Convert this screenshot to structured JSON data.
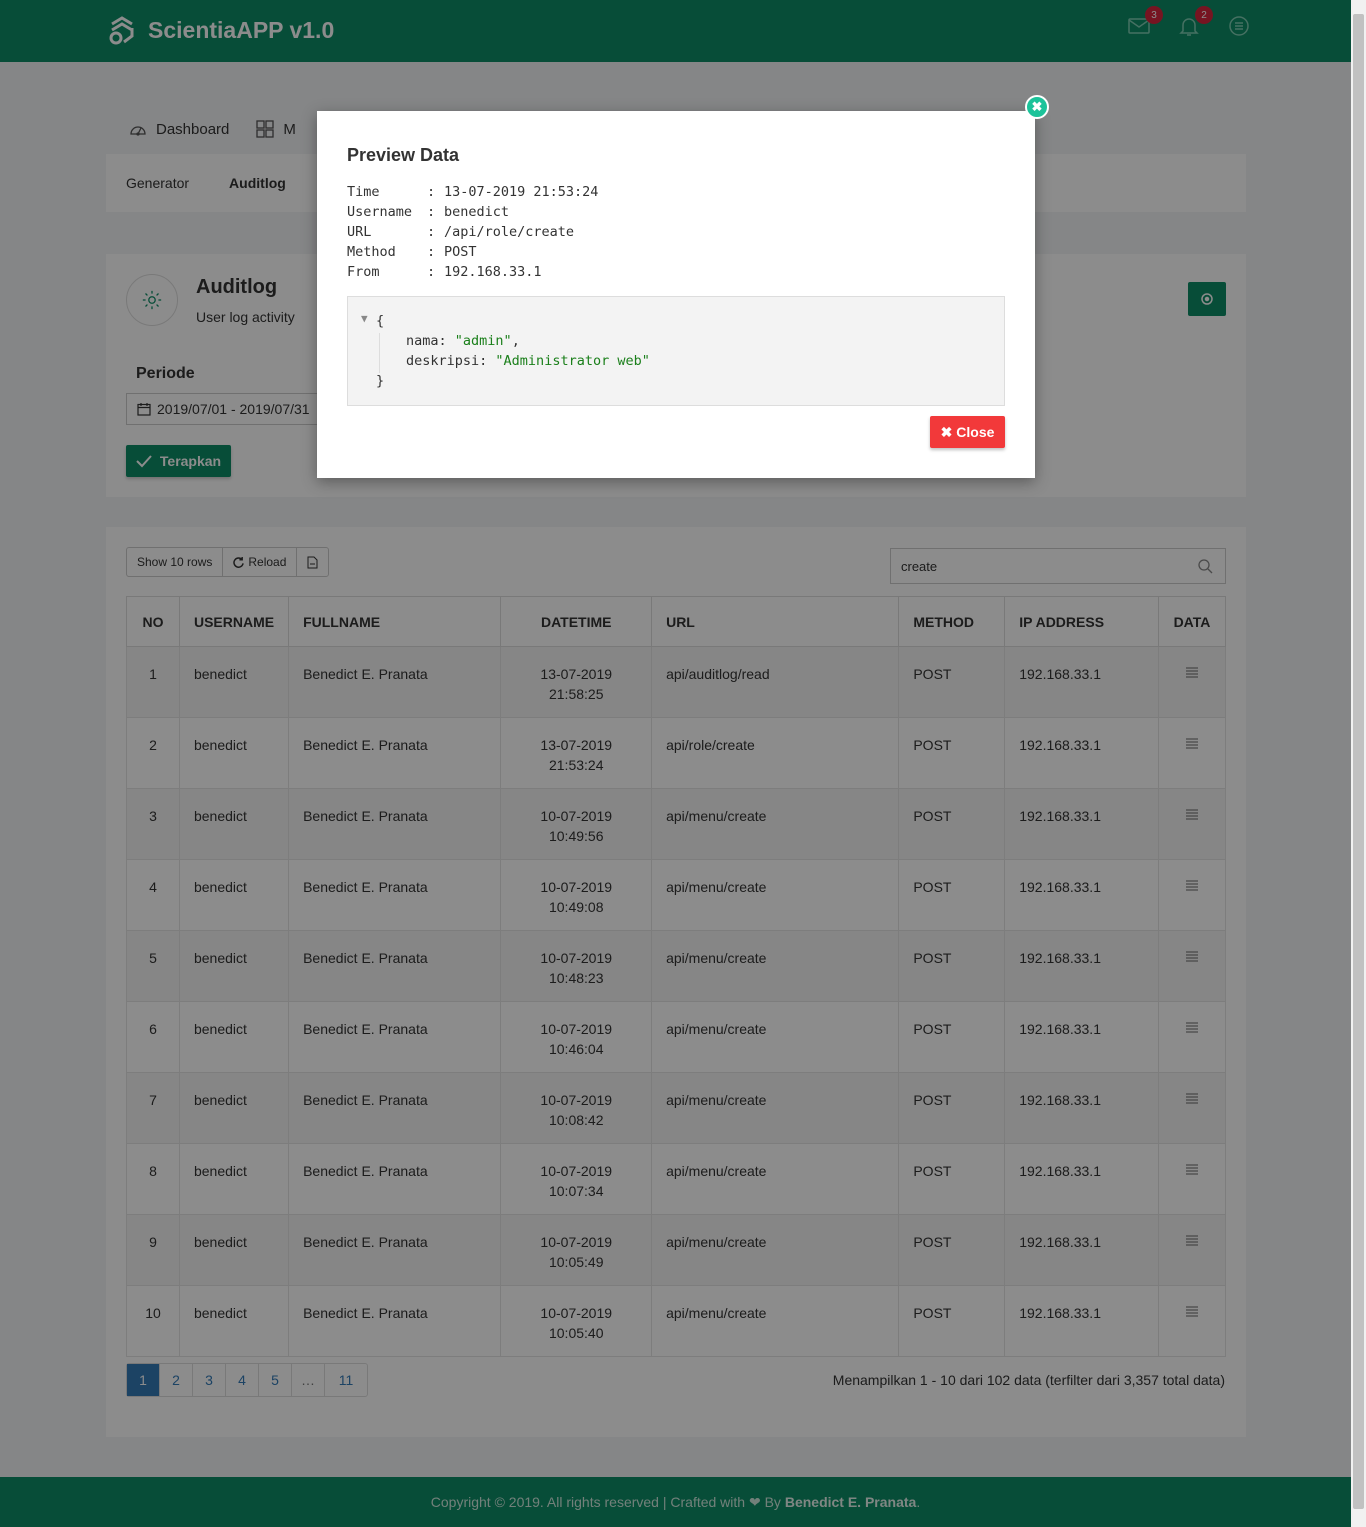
{
  "app": {
    "title": "ScientiaAPP v1.0"
  },
  "navbar": {
    "mail_badge": "3",
    "notif_badge": "2"
  },
  "tabs": {
    "main": [
      {
        "label": "Dashboard"
      },
      {
        "label": "M"
      }
    ],
    "sub": [
      {
        "label": "Generator"
      },
      {
        "label": "Auditlog"
      }
    ]
  },
  "page": {
    "title": "Auditlog",
    "subtitle": "User log activity"
  },
  "filter": {
    "label": "Periode",
    "date_range": "2019/07/01 - 2019/07/31",
    "apply_label": "Terapkan"
  },
  "toolbar": {
    "show_rows": "Show 10 rows",
    "reload": "Reload"
  },
  "search": {
    "value": "create"
  },
  "table": {
    "headers": [
      "NO",
      "USERNAME",
      "FULLNAME",
      "DATETIME",
      "URL",
      "METHOD",
      "IP ADDRESS",
      "DATA"
    ],
    "rows": [
      {
        "no": "1",
        "username": "benedict",
        "fullname": "Benedict E. Pranata",
        "date": "13-07-2019",
        "time": "21:58:25",
        "url": "api/auditlog/read",
        "method": "POST",
        "ip": "192.168.33.1"
      },
      {
        "no": "2",
        "username": "benedict",
        "fullname": "Benedict E. Pranata",
        "date": "13-07-2019",
        "time": "21:53:24",
        "url": "api/role/create",
        "method": "POST",
        "ip": "192.168.33.1"
      },
      {
        "no": "3",
        "username": "benedict",
        "fullname": "Benedict E. Pranata",
        "date": "10-07-2019",
        "time": "10:49:56",
        "url": "api/menu/create",
        "method": "POST",
        "ip": "192.168.33.1"
      },
      {
        "no": "4",
        "username": "benedict",
        "fullname": "Benedict E. Pranata",
        "date": "10-07-2019",
        "time": "10:49:08",
        "url": "api/menu/create",
        "method": "POST",
        "ip": "192.168.33.1"
      },
      {
        "no": "5",
        "username": "benedict",
        "fullname": "Benedict E. Pranata",
        "date": "10-07-2019",
        "time": "10:48:23",
        "url": "api/menu/create",
        "method": "POST",
        "ip": "192.168.33.1"
      },
      {
        "no": "6",
        "username": "benedict",
        "fullname": "Benedict E. Pranata",
        "date": "10-07-2019",
        "time": "10:46:04",
        "url": "api/menu/create",
        "method": "POST",
        "ip": "192.168.33.1"
      },
      {
        "no": "7",
        "username": "benedict",
        "fullname": "Benedict E. Pranata",
        "date": "10-07-2019",
        "time": "10:08:42",
        "url": "api/menu/create",
        "method": "POST",
        "ip": "192.168.33.1"
      },
      {
        "no": "8",
        "username": "benedict",
        "fullname": "Benedict E. Pranata",
        "date": "10-07-2019",
        "time": "10:07:34",
        "url": "api/menu/create",
        "method": "POST",
        "ip": "192.168.33.1"
      },
      {
        "no": "9",
        "username": "benedict",
        "fullname": "Benedict E. Pranata",
        "date": "10-07-2019",
        "time": "10:05:49",
        "url": "api/menu/create",
        "method": "POST",
        "ip": "192.168.33.1"
      },
      {
        "no": "10",
        "username": "benedict",
        "fullname": "Benedict E. Pranata",
        "date": "10-07-2019",
        "time": "10:05:40",
        "url": "api/menu/create",
        "method": "POST",
        "ip": "192.168.33.1"
      }
    ]
  },
  "pagination": {
    "pages": [
      "1",
      "2",
      "3",
      "4",
      "5",
      "…",
      "11"
    ],
    "active": "1"
  },
  "showing": "Menampilkan 1 - 10 dari 102 data (terfilter dari 3,357 total data)",
  "footer": {
    "text": "Copyright © 2019. All rights reserved | Crafted with ❤ By",
    "author": "Benedict E. Pranata",
    "end": "."
  },
  "modal": {
    "title": "Preview Data",
    "fields": [
      {
        "key": "Time",
        "value": "13-07-2019 21:53:24"
      },
      {
        "key": "Username",
        "value": "benedict"
      },
      {
        "key": "URL",
        "value": "/api/role/create"
      },
      {
        "key": "Method",
        "value": "POST"
      },
      {
        "key": "From",
        "value": "192.168.33.1"
      }
    ],
    "json": {
      "open": "{",
      "close": "}",
      "lines": [
        {
          "key": "nama",
          "value": "\"admin\"",
          "sep": ","
        },
        {
          "key": "deskripsi",
          "value": "\"Administrator web\"",
          "sep": ""
        }
      ]
    },
    "close_label": "Close"
  },
  "colors": {
    "primary": "#0e8d66",
    "danger": "#f2393a",
    "link": "#337ab7",
    "badge": "#d7263d"
  }
}
